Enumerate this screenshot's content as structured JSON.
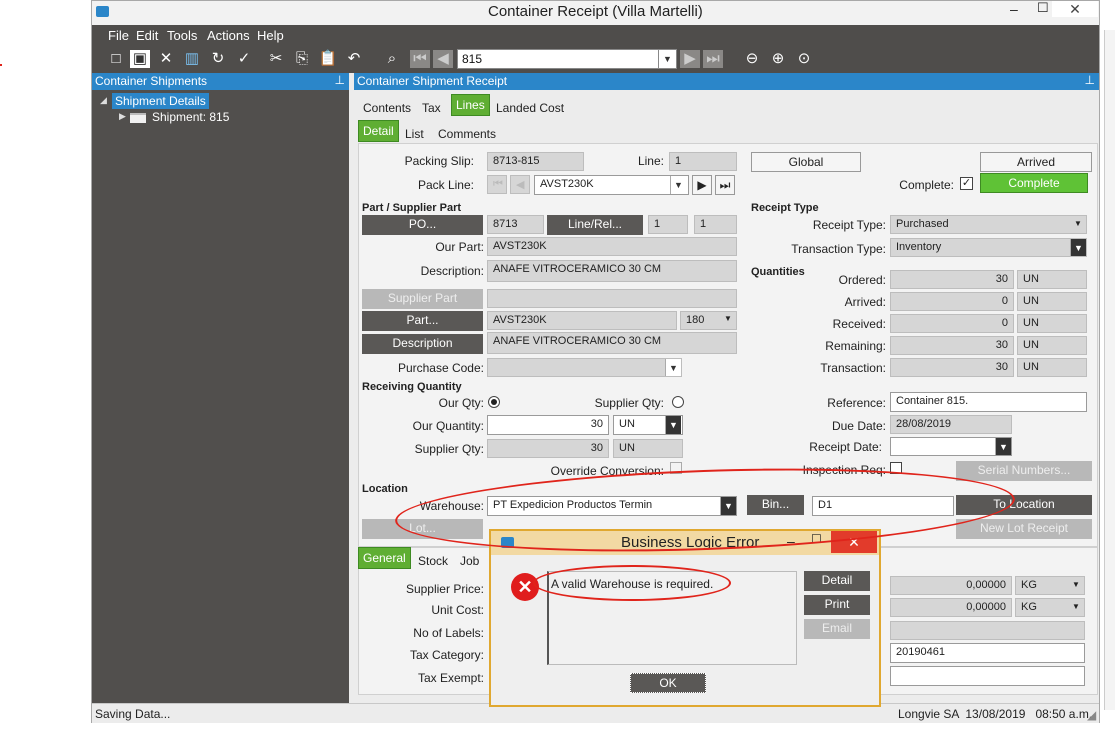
{
  "window": {
    "title": "Container Receipt (Villa Martelli)"
  },
  "menu": [
    "File",
    "Edit",
    "Tools",
    "Actions",
    "Help"
  ],
  "toolbar": {
    "nav_value": "815"
  },
  "left_pane": {
    "header": "Container Shipments",
    "tree_root": "Shipment Details",
    "tree_child": "Shipment: 815"
  },
  "right_pane": {
    "header": "Container Shipment Receipt"
  },
  "top_tabs": [
    "Contents",
    "Tax",
    "Lines",
    "Landed Cost"
  ],
  "sub_tabs": [
    "Detail",
    "List",
    "Comments"
  ],
  "form": {
    "packing_slip_label": "Packing Slip:",
    "packing_slip": "8713-815",
    "line_label": "Line:",
    "line": "1",
    "pack_line_label": "Pack Line:",
    "pack_line": "AVST230K",
    "part_supplier_section": "Part / Supplier Part",
    "po_btn": "PO...",
    "po": "8713",
    "line_rel_btn": "Line/Rel...",
    "line_val": "1",
    "rel_val": "1",
    "our_part_label": "Our Part:",
    "our_part": "AVST230K",
    "description_label": "Description:",
    "description": "ANAFE VITROCERAMICO 30 CM",
    "supplier_part_btn": "Supplier Part",
    "part_btn": "Part...",
    "part": "AVST230K",
    "rev": "180",
    "description_btn": "Description",
    "description2": "ANAFE VITROCERAMICO 30 CM",
    "purchase_code_label": "Purchase Code:",
    "receiving_qty_section": "Receiving Quantity",
    "our_qty_radio": "Our Qty:",
    "supplier_qty_radio": "Supplier Qty:",
    "our_quantity_label": "Our Quantity:",
    "our_quantity": "30",
    "our_quantity_uom": "UN",
    "supplier_qty_label": "Supplier Qty:",
    "supplier_qty": "30",
    "supplier_qty_uom": "UN",
    "override_conversion": "Override Conversion:",
    "location_section": "Location",
    "warehouse_label": "Warehouse:",
    "warehouse": "PT Expedicion Productos Termin",
    "bin_btn": "Bin...",
    "bin": "D1",
    "to_location_btn": "To Location",
    "lot_btn": "Lot...",
    "new_lot_btn": "New Lot Receipt",
    "global_btn": "Global",
    "arrived_btn": "Arrived",
    "complete_label": "Complete:",
    "complete_btn": "Complete",
    "receipt_type_section": "Receipt Type",
    "receipt_type_label": "Receipt Type:",
    "receipt_type": "Purchased",
    "transaction_type_label": "Transaction Type:",
    "transaction_type": "Inventory",
    "quantities_section": "Quantities",
    "qty_rows": [
      {
        "label": "Ordered:",
        "value": "30",
        "uom": "UN"
      },
      {
        "label": "Arrived:",
        "value": "0",
        "uom": "UN"
      },
      {
        "label": "Received:",
        "value": "0",
        "uom": "UN"
      },
      {
        "label": "Remaining:",
        "value": "30",
        "uom": "UN"
      },
      {
        "label": "Transaction:",
        "value": "30",
        "uom": "UN"
      }
    ],
    "reference_label": "Reference:",
    "reference": "Container 815.",
    "due_date_label": "Due Date:",
    "due_date": "28/08/2019",
    "receipt_date_label": "Receipt Date:",
    "inspection_req_label": "Inspection Req:",
    "serial_numbers_btn": "Serial Numbers..."
  },
  "bottom_tabs": [
    "General",
    "Stock",
    "Job"
  ],
  "bottom": {
    "supplier_price_label": "Supplier Price:",
    "unit_cost_label": "Unit Cost:",
    "no_labels_label": "No of Labels:",
    "tax_category_label": "Tax Category:",
    "tax_exempt_label": "Tax Exempt:",
    "price1": "0,00000",
    "uom1": "KG",
    "price2": "0,00000",
    "uom2": "KG",
    "code": "20190461"
  },
  "dialog": {
    "title": "Business Logic Error",
    "message": "A valid Warehouse is required.",
    "detail_btn": "Detail",
    "print_btn": "Print",
    "email_btn": "Email",
    "ok_btn": "OK"
  },
  "status": {
    "left": "Saving Data...",
    "right": "Longvie SA  13/08/2019   08:50 a.m."
  }
}
